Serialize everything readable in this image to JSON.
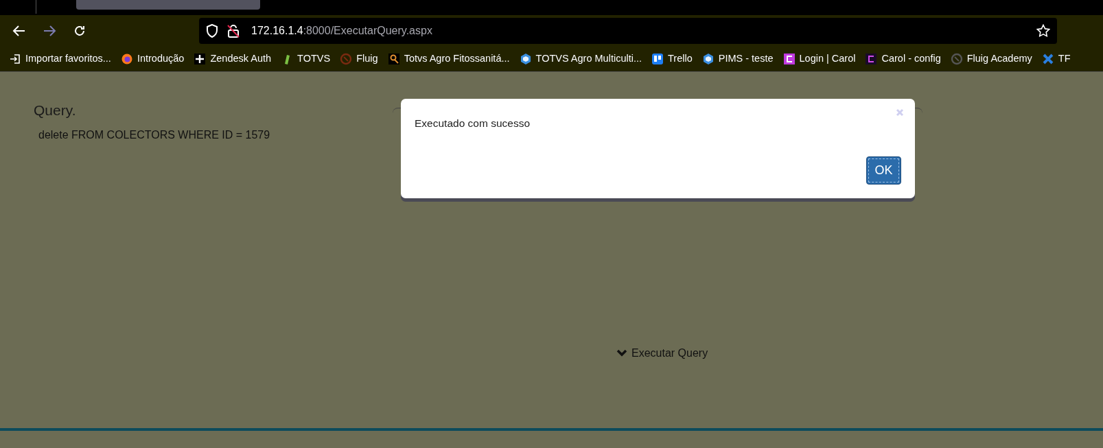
{
  "browser": {
    "url_host": "172.16.1.4",
    "url_path": ":8000/ExecutarQuery.aspx",
    "bookmarks": [
      {
        "label": "Importar favoritos...",
        "kind": "import"
      },
      {
        "label": "Introdução",
        "kind": "fox"
      },
      {
        "label": "Zendesk Auth",
        "kind": "plus"
      },
      {
        "label": "TOTVS",
        "kind": "leaf"
      },
      {
        "label": "Fluig",
        "kind": "ring"
      },
      {
        "label": "Totvs Agro Fitossanitá...",
        "kind": "magnifier"
      },
      {
        "label": "TOTVS Agro Multiculti...",
        "kind": "cube"
      },
      {
        "label": "Trello",
        "kind": "board"
      },
      {
        "label": "PIMS - teste",
        "kind": "cube"
      },
      {
        "label": "Login | Carol",
        "kind": "carol"
      },
      {
        "label": "Carol - config",
        "kind": "carol-dark"
      },
      {
        "label": "Fluig Academy",
        "kind": "ring-grey"
      },
      {
        "label": "TF",
        "kind": "cross"
      }
    ]
  },
  "page": {
    "heading": "Query.",
    "query": "delete FROM COLECTORS WHERE ID = 1579",
    "action": "Executar Query"
  },
  "dialog": {
    "message": "Executado com sucesso",
    "button": "OK"
  }
}
